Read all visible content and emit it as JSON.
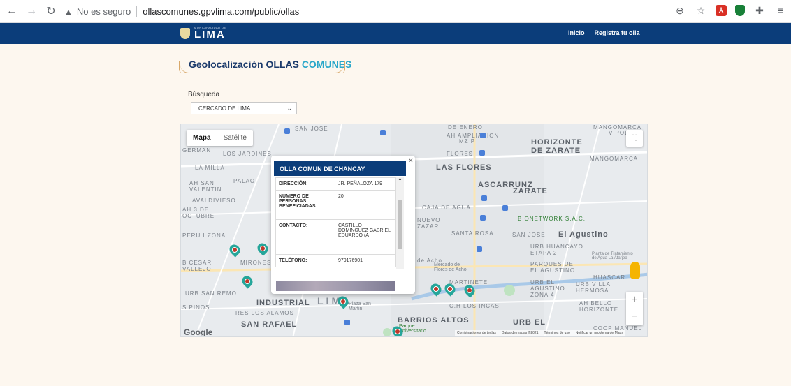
{
  "browser": {
    "insecure_label": "No es seguro",
    "url": "ollascomunes.gpvlima.com/public/ollas",
    "icons": [
      "back-arrow-icon",
      "forward-arrow-icon",
      "reload-icon",
      "warning-icon",
      "zoom-icon",
      "star-icon",
      "pdf-extension-icon",
      "shield-extension-icon",
      "puzzle-icon",
      "menu-icon"
    ]
  },
  "header": {
    "logo_small": "MUNICIPALIDAD DE",
    "logo_big": "LIMA",
    "nav": [
      "Inicio",
      "Registra tu olla"
    ]
  },
  "page": {
    "title_main": "Geolocalización OLLAS ",
    "title_accent": "COMUNES",
    "search_label": "Búsqueda",
    "select_value": "CERCADO DE LIMA"
  },
  "map": {
    "type_controls": [
      "Mapa",
      "Satélite"
    ],
    "labels": {
      "san_jose": "SAN JOSE",
      "de_enero": "DE ENERO",
      "ampliacion": "AH AMPLIACION",
      "mz_p": "MZ P",
      "mangomarca1": "MANGOMARCA",
      "vipol": "VIPOL",
      "german": "GERMAN",
      "jardines": "LOS JARDINES",
      "horizonte": "HORIZONTE",
      "de_zarate": "DE ZARATE",
      "mangomarca2": "MANGOMARCA",
      "flores": "FLORES",
      "la_milla": "LA MILLA",
      "las_flores": "LAS FLORES",
      "ah_san_valentin": "AH SAN\nVALENTIN",
      "palao": "PALAO",
      "ascarrunz": "ASCARRUNZ",
      "zarate": "ZARATE",
      "avaldivieso": "AVALDIVIESO",
      "ah3": "AH 3 DE\nOCTUBRE",
      "caja_de_agua": "CAJA DE AGUA",
      "bionetwork": "BIONETWORK S.A.C.",
      "peru1": "PERU I ZONA",
      "nuevo": "NUEVO\nZAZAR",
      "santa_rosa": "SANTA ROSA",
      "san_jose2": "SAN JOSE",
      "el_agustino": "El Agustino",
      "urb_huancayo": "URB HUANCAYO\nETAPA 2",
      "planta": "Planta de Tratamiento\nde Agua La Atarjea",
      "cesar_vallejo": "B CESAR\nVALLEJO",
      "mirones": "MIRONES A",
      "de_acho": "de Acho",
      "mercado": "Mercado de\nFlores de Acho",
      "parques": "PARQUES DE\nEL AGUSTINO",
      "urb_san_remo": "URB SAN REMO",
      "martinete": "MARTINETE",
      "urb_el_agustino": "URB EL\nAGUSTINO\nZONA 4",
      "urb_villa": "URB VILLA\nHERMOSA",
      "huascar": "HUASCAR",
      "industrial": "INDUSTRIAL",
      "lima": "LIMA",
      "plaza_san_martin": "Plaza San\nMartin",
      "los_incas": "C.H LOS INCAS",
      "ah_bello": "AH BELLO\nHORIZONTE",
      "pinos": "S PINOS",
      "res_los_alamos": "RES LOS ALAMOS",
      "barrios_altos": "BARRIOS ALTOS",
      "san_rafael": "SAN RAFAEL",
      "parque_universitario": "Parque\nUniversitario",
      "urb_el2": "URB EL",
      "coop_manuel": "COOP MANUEL"
    },
    "google": "Google",
    "footer": [
      "Combinaciones de teclas",
      "Datos de mapas ©2021",
      "Términos de uso",
      "Notificar un problema de Maps"
    ]
  },
  "info_window": {
    "title": "OLLA COMUN DE CHANCAY",
    "rows": [
      {
        "key": "DIRECCIÓN:",
        "value": "JR. PEÑALOZA 179"
      },
      {
        "key": "NÚMERO DE PERSONAS BENEFICIADAS:",
        "value": "20"
      },
      {
        "key": "CONTACTO:",
        "value": "CASTILLO DOMINGUEZ GABRIEL EDUARDO (A"
      },
      {
        "key": "TELÉFONO:",
        "value": "979176901"
      }
    ]
  }
}
